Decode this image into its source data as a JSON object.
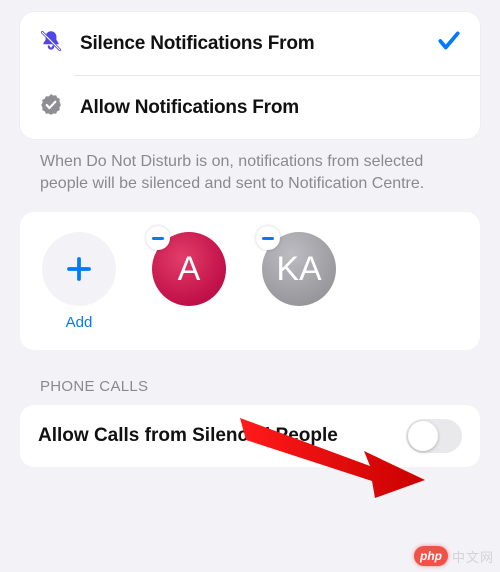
{
  "options": {
    "silence": {
      "label": "Silence Notifications From",
      "selected": true
    },
    "allow": {
      "label": "Allow Notifications From",
      "selected": false
    }
  },
  "description": "When Do Not Disturb is on, notifications from selected people will be silenced and sent to Notification Centre.",
  "people": {
    "add_label": "Add",
    "items": [
      {
        "initials": "A",
        "name": ""
      },
      {
        "initials": "KA",
        "name": ""
      }
    ]
  },
  "phone_calls": {
    "header": "PHONE CALLS",
    "toggle_label": "Allow Calls from Silenced People",
    "toggle_on": false
  },
  "watermark": {
    "badge": "php",
    "text": "中文网"
  }
}
